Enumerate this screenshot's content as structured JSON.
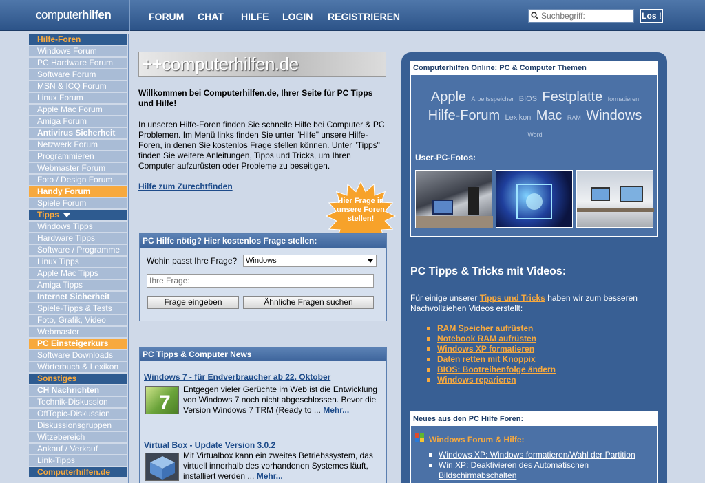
{
  "header": {
    "logo_light": "computer",
    "logo_bold": "hilfen",
    "nav": [
      "FORUM",
      "CHAT",
      "HILFE",
      "LOGIN",
      "REGISTRIEREN"
    ],
    "search_placeholder": "Suchbegriff:",
    "search_button": "Los !"
  },
  "sidebar": {
    "items": [
      {
        "label": "Hilfe-Foren",
        "type": "sec"
      },
      {
        "label": "Windows Forum",
        "type": "item"
      },
      {
        "label": "PC Hardware Forum",
        "type": "item"
      },
      {
        "label": "Software Forum",
        "type": "item"
      },
      {
        "label": "MSN & ICQ Forum",
        "type": "item"
      },
      {
        "label": "Linux Forum",
        "type": "item"
      },
      {
        "label": "Apple Mac Forum",
        "type": "item"
      },
      {
        "label": "Amiga Forum",
        "type": "item"
      },
      {
        "label": "Antivirus Sicherheit",
        "type": "bold"
      },
      {
        "label": "Netzwerk Forum",
        "type": "item"
      },
      {
        "label": "Programmieren",
        "type": "item"
      },
      {
        "label": "Webmaster Forum",
        "type": "item"
      },
      {
        "label": "Foto / Design Forum",
        "type": "item"
      },
      {
        "label": "Handy Forum",
        "type": "hl"
      },
      {
        "label": "Spiele Forum",
        "type": "item"
      },
      {
        "label": "Tipps",
        "type": "sec",
        "dropdown": true
      },
      {
        "label": "Windows Tipps",
        "type": "item"
      },
      {
        "label": "Hardware Tipps",
        "type": "item"
      },
      {
        "label": "Software / Programme",
        "type": "item"
      },
      {
        "label": "Linux Tipps",
        "type": "item"
      },
      {
        "label": "Apple Mac Tipps",
        "type": "item"
      },
      {
        "label": "Amiga Tipps",
        "type": "item"
      },
      {
        "label": "Internet Sicherheit",
        "type": "bold"
      },
      {
        "label": "Spiele-Tipps & Tests",
        "type": "item"
      },
      {
        "label": "Foto, Grafik, Video",
        "type": "item"
      },
      {
        "label": "Webmaster",
        "type": "item"
      },
      {
        "label": "PC Einsteigerkurs",
        "type": "hl"
      },
      {
        "label": "Software Downloads",
        "type": "item"
      },
      {
        "label": "Wörterbuch & Lexikon",
        "type": "item"
      },
      {
        "label": "Sonstiges",
        "type": "sec"
      },
      {
        "label": "CH Nachrichten",
        "type": "bold"
      },
      {
        "label": "Technik-Diskussion",
        "type": "item"
      },
      {
        "label": "OffTopic-Diskussion",
        "type": "item"
      },
      {
        "label": "Diskussionsgruppen",
        "type": "item"
      },
      {
        "label": "Witzebereich",
        "type": "item"
      },
      {
        "label": "Ankauf / Verkauf",
        "type": "item"
      },
      {
        "label": "Link-Tipps",
        "type": "item"
      },
      {
        "label": "Computerhilfen.de",
        "type": "sec"
      }
    ]
  },
  "main": {
    "banner": "++computerhilfen.de",
    "welcome": "Willkommen bei Computerhilfen.de, Ihrer Seite für PC Tipps und Hilfe!",
    "intro": "In unseren Hilfe-Foren finden Sie schnelle Hilfe bei Computer & PC Problemen. Im Menü links finden Sie unter \"Hilfe\" unsere Hilfe-Foren, in denen Sie kostenlos Frage stellen können. Unter \"Tipps\" finden Sie weitere Anleitungen, Tipps und Tricks, um Ihren Computer aufzurüsten oder Probleme zu beseitigen.",
    "help_link": "Hilfe zum Zurechtfinden",
    "starburst": "Hier Frage in unsere Foren stellen!",
    "ask": {
      "title": "PC Hilfe nötig? Hier kostenlos Frage stellen:",
      "where_label": "Wohin passt Ihre Frage?",
      "where_value": "Windows",
      "question_placeholder": "Ihre Frage:",
      "submit": "Frage eingeben",
      "similar": "Ähnliche Fragen suchen"
    },
    "news": {
      "title": "PC Tipps & Computer News",
      "items": [
        {
          "title": "Windows 7 - für Endverbraucher ab 22. Oktober",
          "text": "Entgegen vieler Gerüchte im Web ist die Entwicklung von Windows 7 noch nicht abgeschlossen. Bevor die Version Windows 7 TRM (Ready to ...",
          "more": "Mehr..."
        },
        {
          "title": "Virtual Box - Update Version 3.0.2",
          "text": "Mit Virtualbox kann ein zweites Betriebssystem, das virtuell innerhalb des vorhandenen Systemes läuft, installiert werden ...",
          "more": "Mehr..."
        }
      ]
    }
  },
  "right": {
    "themes_title": "Computerhilfen Online: PC & Computer Themen",
    "cloud": [
      {
        "t": "Apple",
        "s": "big"
      },
      {
        "t": "Arbeitsspeicher",
        "s": "tiny"
      },
      {
        "t": "BIOS",
        "s": "small"
      },
      {
        "t": "Festplatte",
        "s": "big"
      },
      {
        "t": "formatieren",
        "s": "tiny"
      },
      {
        "t": "Hilfe-Forum",
        "s": "big"
      },
      {
        "t": "Lexikon",
        "s": "small"
      },
      {
        "t": "Mac",
        "s": "big"
      },
      {
        "t": "RAM",
        "s": "tiny"
      },
      {
        "t": "Windows",
        "s": "big"
      },
      {
        "t": "Word",
        "s": "tiny"
      }
    ],
    "userpc": "User-PC-Fotos:",
    "video_heading": "PC Tipps & Tricks mit Videos:",
    "video_text_1": "Für einige unserer ",
    "video_text_link": "Tipps und Tricks",
    "video_text_2": " haben wir zum besseren Nachvollziehen Videos erstellt:",
    "video_links": [
      "RAM Speicher aufrüsten",
      "Notebook RAM aufrüsten",
      "Windows XP formatieren",
      "Daten retten mit Knoppix",
      "BIOS: Bootreihenfolge ändern",
      "Windows reparieren"
    ],
    "forum_title": "Neues aus den PC Hilfe Foren:",
    "forum_sub": "Windows Forum & Hilfe:",
    "forum_links": [
      "Windows XP: Windows formatieren/Wahl der Partition",
      "Win XP: Deaktivieren des Automatischen Bildschirmabschalten"
    ]
  }
}
